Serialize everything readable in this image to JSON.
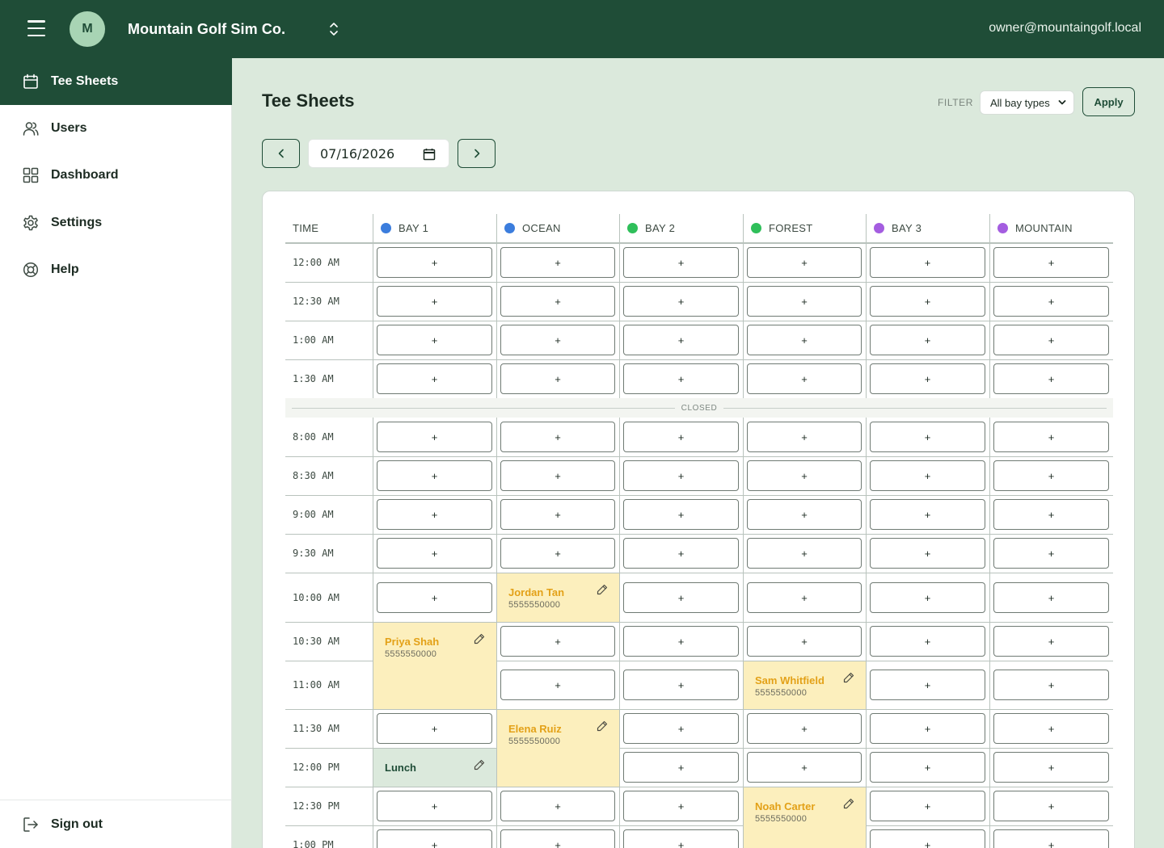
{
  "topbar": {
    "avatar_initial": "M",
    "org_name": "Mountain Golf Sim Co.",
    "user_email": "owner@mountaingolf.local"
  },
  "sidebar": {
    "items": [
      {
        "label": "Tee Sheets",
        "icon": "calendar-icon",
        "active": true
      },
      {
        "label": "Users",
        "icon": "users-icon"
      },
      {
        "label": "Dashboard",
        "icon": "grid-icon"
      },
      {
        "label": "Settings",
        "icon": "gear-icon"
      },
      {
        "label": "Help",
        "icon": "lifebuoy-icon"
      }
    ],
    "signout_label": "Sign out"
  },
  "page": {
    "title": "Tee Sheets",
    "filter_label": "FILTER",
    "filter_value": "All bay types",
    "apply_label": "Apply",
    "date_value": "07/16/2026"
  },
  "colors": {
    "brand": "#1f4d37",
    "booking_bg": "#fcefbd",
    "booking_name": "#e3a118",
    "bay_blue": "#3b7ddd",
    "bay_green": "#2fbf5a",
    "bay_purple": "#a45de0"
  },
  "sheet": {
    "time_header": "TIME",
    "bays": [
      {
        "name": "BAY 1",
        "color": "#3b7ddd"
      },
      {
        "name": "OCEAN",
        "color": "#3b7ddd"
      },
      {
        "name": "BAY 2",
        "color": "#2fbf5a"
      },
      {
        "name": "FOREST",
        "color": "#2fbf5a"
      },
      {
        "name": "BAY 3",
        "color": "#a45de0"
      },
      {
        "name": "MOUNTAIN",
        "color": "#a45de0"
      }
    ],
    "slot_label": "+",
    "closed_label": "CLOSED",
    "times_early": [
      "12:00 AM",
      "12:30 AM",
      "1:00 AM",
      "1:30 AM"
    ],
    "times_day": [
      "8:00 AM",
      "8:30 AM",
      "9:00 AM",
      "9:30 AM",
      "10:00 AM",
      "10:30 AM",
      "11:00 AM",
      "11:30 AM",
      "12:00 PM",
      "12:30 PM",
      "1:00 PM"
    ],
    "bookings": [
      {
        "name": "Jordan Tan",
        "phone": "5555550000"
      },
      {
        "name": "Priya Shah",
        "phone": "5555550000"
      },
      {
        "name": "Sam Whitfield",
        "phone": "5555550000"
      },
      {
        "name": "Elena Ruiz",
        "phone": "5555550000"
      },
      {
        "name": "Lunch"
      },
      {
        "name": "Noah Carter",
        "phone": "5555550000"
      }
    ]
  }
}
